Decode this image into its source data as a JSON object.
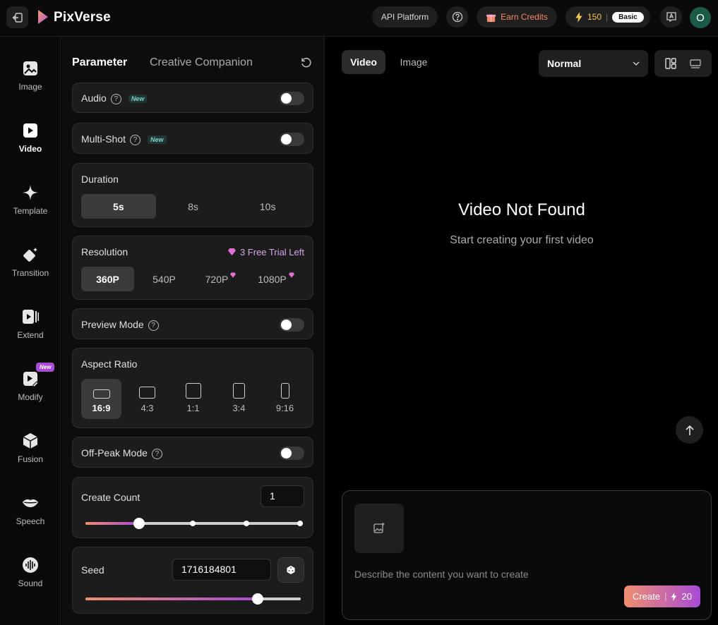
{
  "app": {
    "name": "PixVerse"
  },
  "header": {
    "api_platform": "API Platform",
    "earn_credits": "Earn Credits",
    "credits": "150",
    "separator": "|",
    "plan": "Basic",
    "avatar_initial": "O"
  },
  "nav": {
    "items": [
      {
        "label": "Image"
      },
      {
        "label": "Video"
      },
      {
        "label": "Template"
      },
      {
        "label": "Transition"
      },
      {
        "label": "Extend"
      },
      {
        "label": "Modify",
        "badge": "New"
      },
      {
        "label": "Fusion"
      },
      {
        "label": "Speech"
      },
      {
        "label": "Sound"
      }
    ],
    "active": "Video"
  },
  "panel": {
    "tabs": {
      "parameter": "Parameter",
      "companion": "Creative Companion"
    },
    "audio": {
      "label": "Audio",
      "badge": "New",
      "help": "?"
    },
    "multishot": {
      "label": "Multi-Shot",
      "badge": "New",
      "help": "?"
    },
    "duration": {
      "label": "Duration",
      "options": [
        "5s",
        "8s",
        "10s"
      ],
      "selected": "5s"
    },
    "resolution": {
      "label": "Resolution",
      "trial": "3 Free Trial Left",
      "options": [
        "360P",
        "540P",
        "720P",
        "1080P"
      ],
      "selected": "360P"
    },
    "preview": {
      "label": "Preview Mode",
      "help": "?"
    },
    "aspect": {
      "label": "Aspect Ratio",
      "options": [
        "16:9",
        "4:3",
        "1:1",
        "3:4",
        "9:16"
      ],
      "selected": "16:9"
    },
    "offpeak": {
      "label": "Off-Peak Mode",
      "help": "?"
    },
    "count": {
      "label": "Create Count",
      "value": "1"
    },
    "seed": {
      "label": "Seed",
      "value": "1716184801"
    }
  },
  "main": {
    "tabs": {
      "video": "Video",
      "image": "Image"
    },
    "mode": "Normal",
    "empty_title": "Video Not Found",
    "empty_sub": "Start creating your first video",
    "prompt_placeholder": "Describe the content you want to create",
    "create_label": "Create",
    "create_separator": "|",
    "create_cost": "20"
  },
  "colors": {
    "accent_gradient_start": "#f08e6e",
    "accent_gradient_end": "#a94bd6",
    "panel_bg": "#1c1c1c"
  }
}
